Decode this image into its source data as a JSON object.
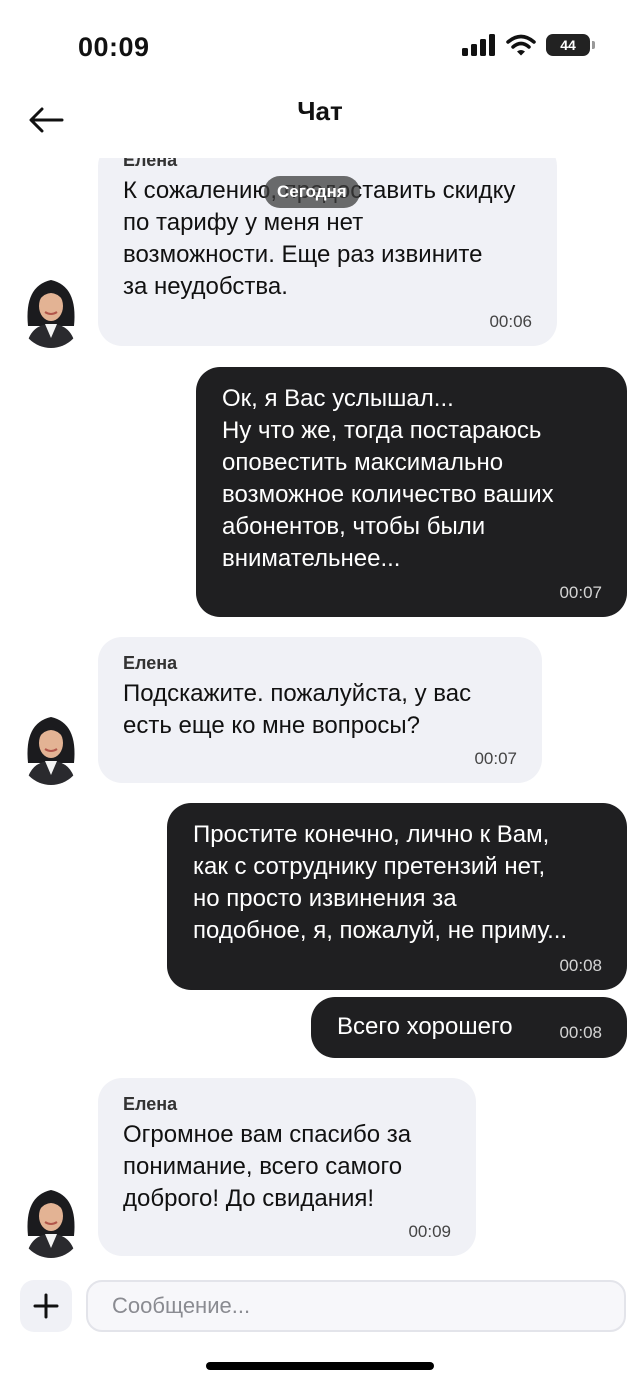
{
  "status_bar": {
    "time": "00:09",
    "battery": "44"
  },
  "header": {
    "title": "Чат"
  },
  "date_divider": "Сегодня",
  "messages": [
    {
      "direction": "in",
      "sender": "Елена",
      "text": "К сожалению, предоставить скидку\nпо тарифу у меня нет\nвозможности. Еще раз извините\nза неудобства.",
      "time": "00:06"
    },
    {
      "direction": "out",
      "text": "Ок, я Вас услышал...\nНу что же, тогда постараюсь\nоповестить максимально\nвозможное количество ваших\nабонентов, чтобы были\nвнимательнее...",
      "time": "00:07"
    },
    {
      "direction": "in",
      "sender": "Елена",
      "text": "Подскажите. пожалуйста, у вас\nесть еще ко мне вопросы?",
      "time": "00:07"
    },
    {
      "direction": "out",
      "text": "Простите конечно, лично к Вам,\nкак с сотруднику претензий нет,\nно просто извинения за\nподобное, я, пожалуй, не приму...",
      "time": "00:08"
    },
    {
      "direction": "out",
      "text": "Всего хорошего",
      "time": "00:08"
    },
    {
      "direction": "in",
      "sender": "Елена",
      "text": "Огромное вам спасибо за\nпонимание, всего самого\nдоброго! До свидания!",
      "time": "00:09"
    }
  ],
  "composer": {
    "placeholder": "Сообщение..."
  },
  "colors": {
    "incoming_bubble": "#f0f1f6",
    "outgoing_bubble": "#1f1f21"
  }
}
